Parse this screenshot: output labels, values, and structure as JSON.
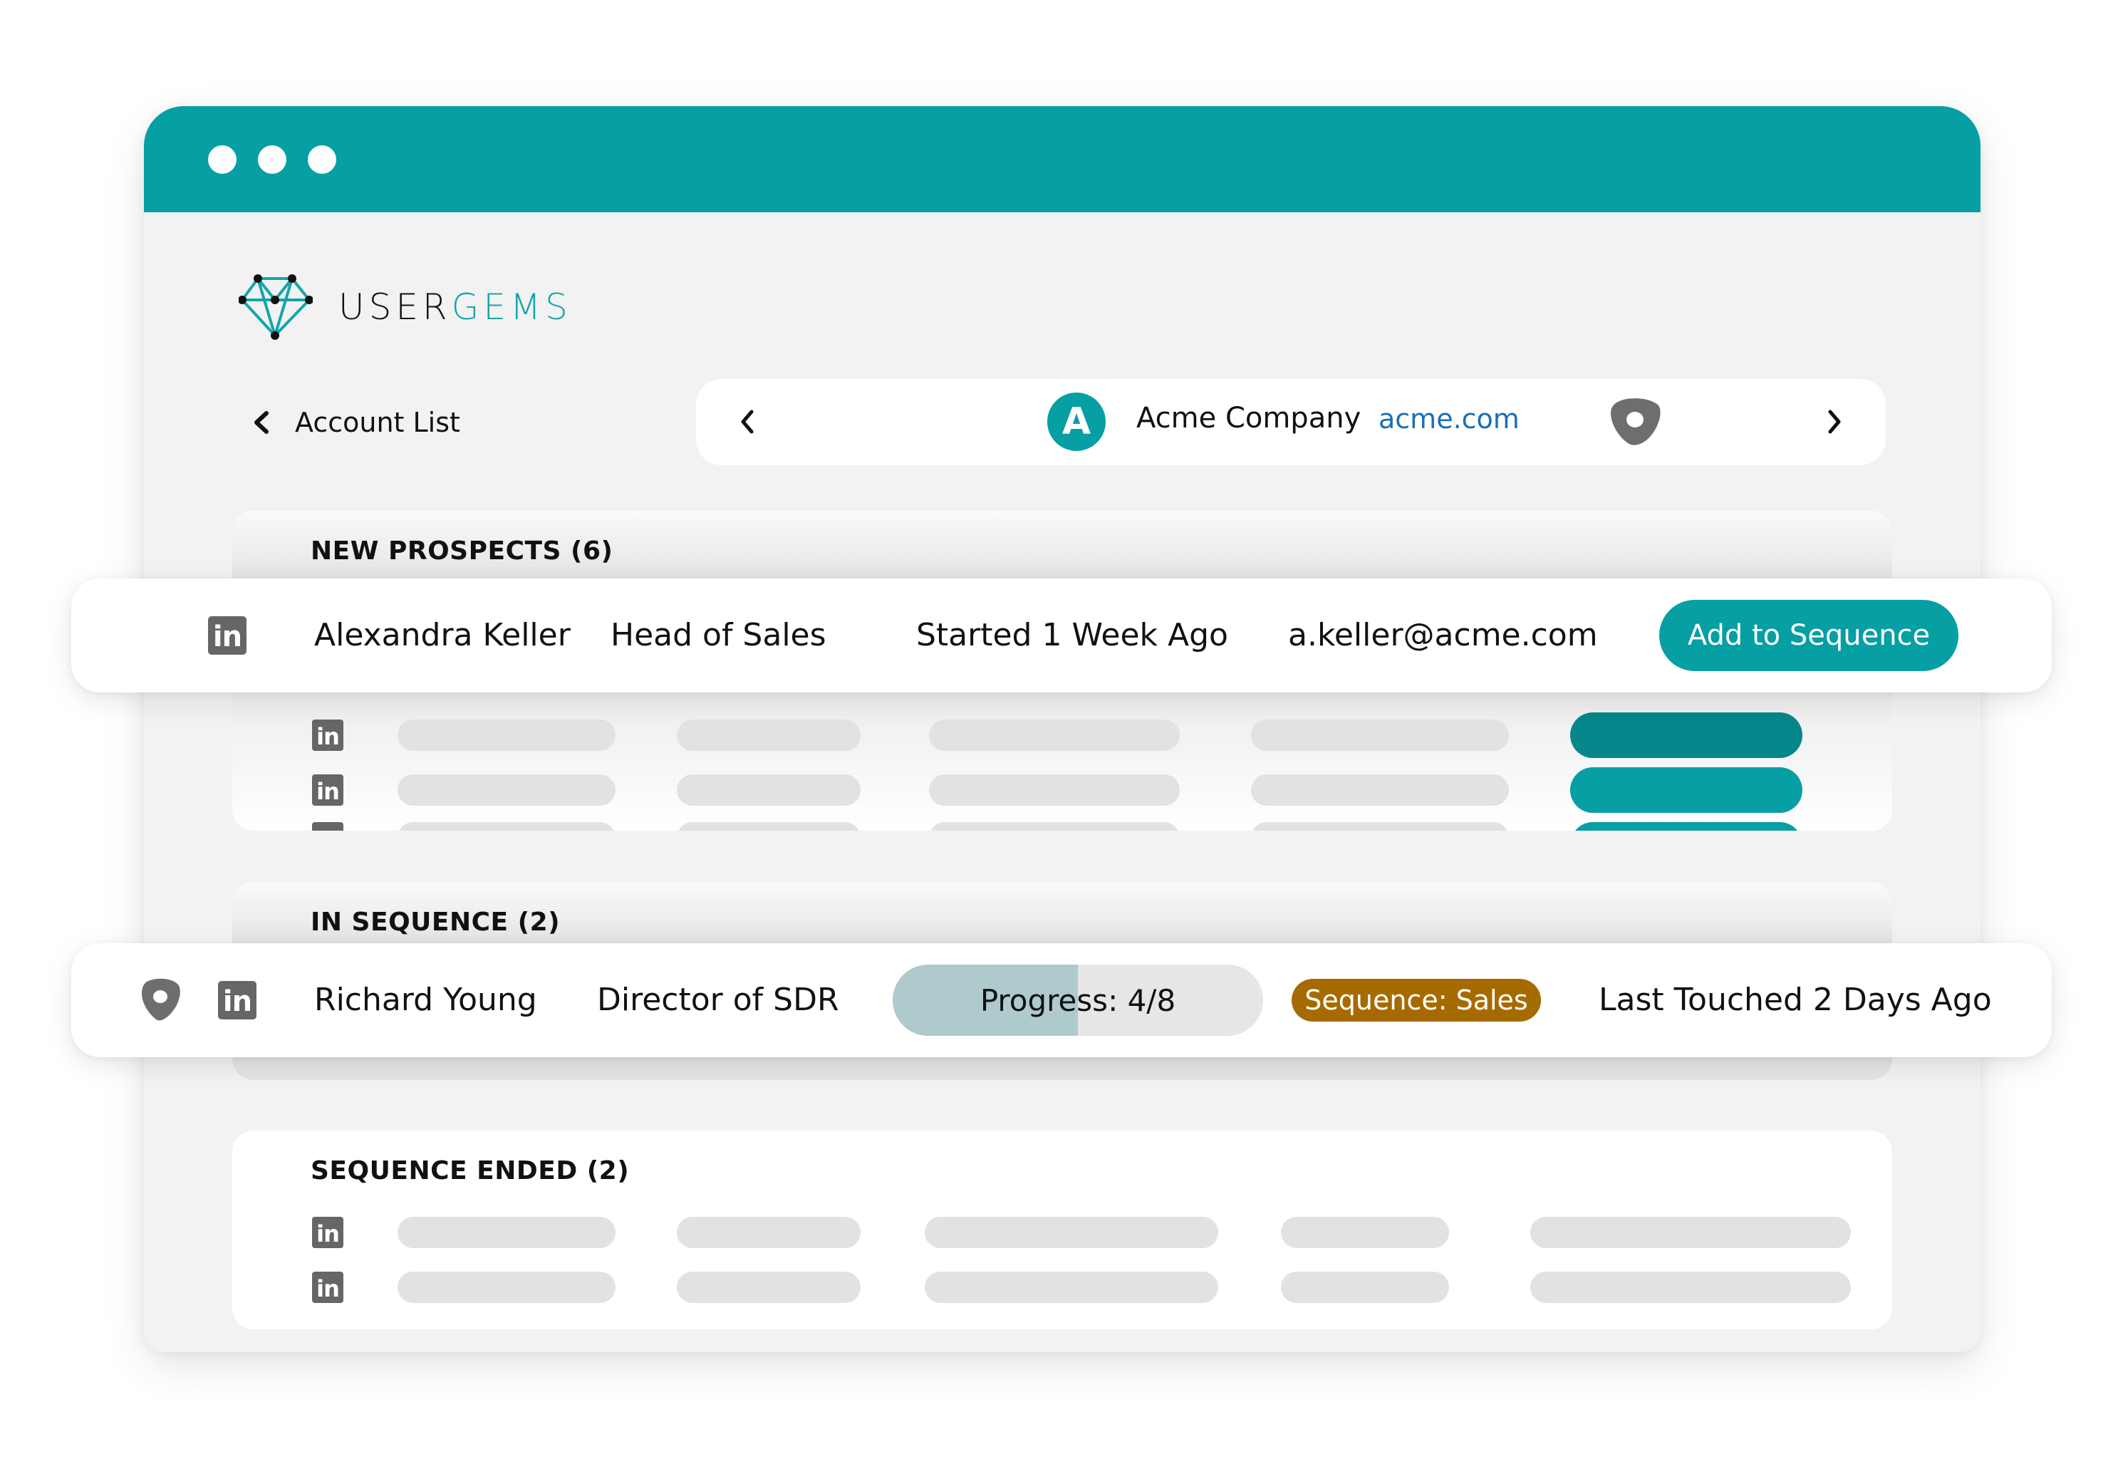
{
  "window": {
    "controls": [
      "dot",
      "dot",
      "dot"
    ]
  },
  "brand": {
    "logo_part1": "USER",
    "logo_part2": "GEMS",
    "accent_color": "#069fa4"
  },
  "breadcrumb": {
    "back_label": "Account List"
  },
  "account_nav": {
    "avatar_letter": "A",
    "company_name": "Acme Company",
    "company_domain": "acme.com",
    "icons": [
      "chevron-left-icon",
      "outreach-icon",
      "chevron-right-icon"
    ]
  },
  "sections": {
    "new_prospects": {
      "title": "NEW PROSPECTS (6)",
      "featured_row": {
        "icon": "linkedin-icon",
        "name": "Alexandra Keller",
        "title": "Head of Sales",
        "status": "Started 1 Week Ago",
        "email": "a.keller@acme.com",
        "action_label": "Add to Sequence"
      },
      "placeholder_rows": 3
    },
    "in_sequence": {
      "title": "IN SEQUENCE (2)",
      "featured_row": {
        "icons": [
          "outreach-icon",
          "linkedin-icon"
        ],
        "name": "Richard Young",
        "title": "Director of SDR",
        "progress_label": "Progress: 4/8",
        "progress_fraction": 0.5,
        "sequence_badge": "Sequence: Sales",
        "sequence_badge_color": "#a66b00",
        "last_touched": "Last Touched 2 Days Ago"
      }
    },
    "sequence_ended": {
      "title": "SEQUENCE ENDED (2)",
      "placeholder_rows": 2
    }
  },
  "linkedin_glyph": "in"
}
